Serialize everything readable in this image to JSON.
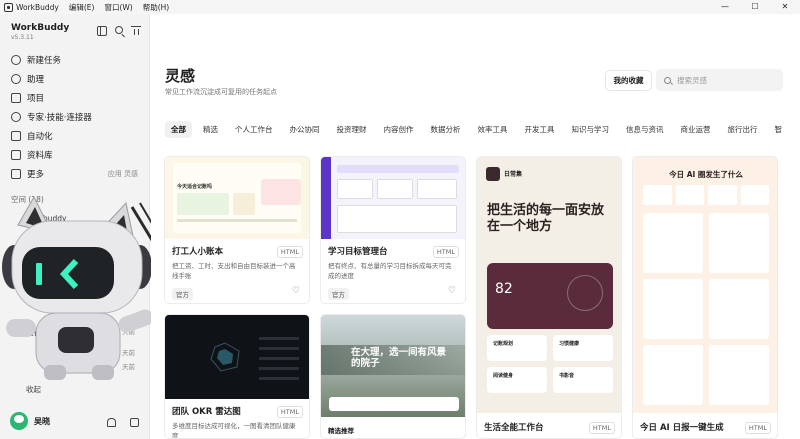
{
  "menubar": {
    "app_name": "WorkBuddy",
    "menus": [
      "编辑(E)",
      "窗口(W)",
      "帮助(H)"
    ],
    "window_controls": [
      "—",
      "☐",
      "✕"
    ]
  },
  "sidebar": {
    "brand": "WorkBuddy",
    "version": "v5.3.11",
    "items": [
      {
        "label": "新建任务",
        "icon": "plus-circle-icon"
      },
      {
        "label": "助理",
        "icon": "chat-icon"
      },
      {
        "label": "项目",
        "icon": "folder-icon"
      },
      {
        "label": "专家·技能·连接器",
        "icon": "bulb-icon"
      },
      {
        "label": "自动化",
        "icon": "automation-icon"
      },
      {
        "label": "资料库",
        "icon": "book-icon"
      },
      {
        "label": "更多",
        "icon": "grid-icon",
        "extra": "应用 灵感"
      }
    ],
    "space_label": "空间 (18)",
    "space_item": "Workbuddy",
    "partial_labels": [
      "施行",
      "天前",
      "天前",
      "天前"
    ],
    "collect_label": "收起",
    "user_name": "吴晓"
  },
  "main": {
    "title": "灵感",
    "subtitle": "常见工作流沉淀成可复用的任务起点",
    "my_collection": "我的收藏",
    "search_placeholder": "搜索灵感",
    "categories": [
      "全部",
      "精选",
      "个人工作台",
      "办公协同",
      "投资理财",
      "内容创作",
      "数据分析",
      "效率工具",
      "开发工具",
      "知识与学习",
      "信息与资讯",
      "商业运营",
      "旅行出行",
      "智"
    ],
    "active_category": "全部",
    "cards": [
      {
        "title": "打工人小账本",
        "tag": "HTML",
        "desc": "把工资、工时、支出和自由目标装进一个高线手账",
        "official": "官方",
        "thumb_text": "今天适合记账吗"
      },
      {
        "title": "学习目标管理台",
        "tag": "HTML",
        "desc": "把有终点、有总量的学习目标拆成每天可完成的进度",
        "official": "官方",
        "thumb_text": ""
      },
      {
        "title": "团队 OKR 雷达图",
        "tag": "HTML",
        "desc": "多维度目标达成可视化，一图看清团队健康度",
        "official": "",
        "thumb_text": ""
      },
      {
        "title": "",
        "tag": "",
        "desc": "",
        "official": "",
        "thumb_text": "在大理，选一间有风景的院子"
      },
      {
        "title": "生活全能工作台",
        "tag": "HTML",
        "desc": "",
        "official": "",
        "thumb_text": "把生活的每一面安放在一个地方",
        "thumb_badge": "日常集",
        "thumb_number": "82",
        "thumb_tiles": [
          "记账规划",
          "习惯健康",
          "阅读健身",
          "书影音"
        ]
      },
      {
        "title": "今日 AI 日报一键生成",
        "tag": "HTML",
        "desc": "",
        "official": "",
        "thumb_text": "今日 AI 圈发生了什么"
      },
      {
        "title": "精选推荐",
        "tag": "",
        "desc": "",
        "official": "",
        "thumb_text": ""
      }
    ]
  },
  "colors": {
    "accent_green": "#2bb673",
    "dark_maroon": "#5a2b3b",
    "ai_orange": "#f07a2e"
  }
}
